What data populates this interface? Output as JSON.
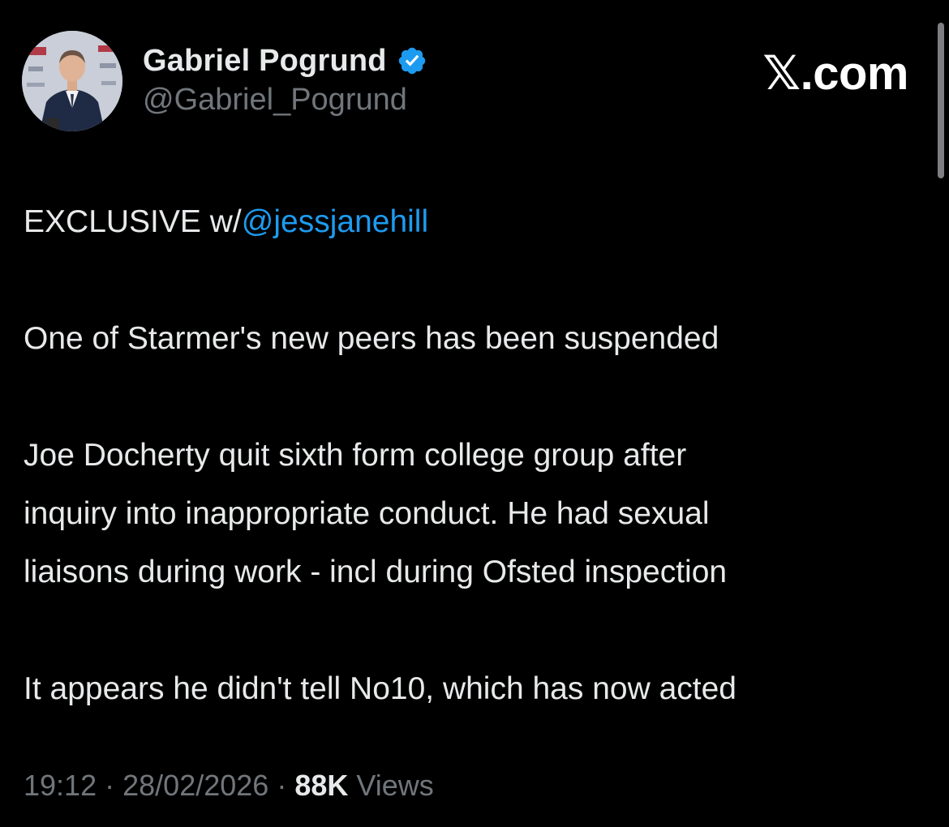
{
  "author": {
    "display_name": "Gabriel Pogrund",
    "handle": "@Gabriel_Pogrund",
    "verified": true,
    "verified_color": "#1d9bf0"
  },
  "brand": "𝕏.com",
  "tweet": {
    "lead": "EXCLUSIVE w/",
    "mention": "@jessjanehill",
    "paragraph_1": "One of Starmer's new peers has been suspended",
    "paragraph_2_lines": [
      "Joe Docherty quit sixth form college group after",
      "inquiry into inappropriate conduct. He had sexual",
      "liaisons during work - incl during Ofsted inspection"
    ],
    "paragraph_3": "It appears he didn't tell No10, which has now acted"
  },
  "meta": {
    "time": "19:12",
    "date": "28/02/2026",
    "views_count": "88K",
    "views_label": "Views",
    "separator": "·"
  },
  "colors": {
    "background": "#000000",
    "text": "#e7e9ea",
    "secondary_text": "#71767b",
    "link": "#1d9bf0"
  }
}
